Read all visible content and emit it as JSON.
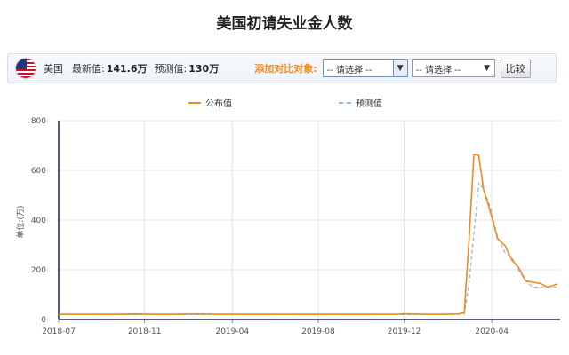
{
  "page": {
    "title": "美国初请失业金人数"
  },
  "toolbar": {
    "flag_icon": "us-flag-icon",
    "country": "美国",
    "latest_label": "最新值:",
    "latest_value": "141.6万",
    "forecast_label": "预测值:",
    "forecast_value": "130万",
    "compare_label": "添加对比对象:",
    "select1_value": "-- 请选择 --",
    "select2_value": "-- 请选择 --",
    "compare_button": "比较"
  },
  "colors": {
    "actual": "#f08a1c",
    "forecast": "#8fbbe0",
    "accent": "#f08a1c"
  },
  "chart_data": {
    "type": "line",
    "title": "",
    "xlabel": "",
    "ylabel": "单位:(万)",
    "ylim": [
      0,
      800
    ],
    "yticks": [
      "0",
      "200",
      "400",
      "600",
      "800"
    ],
    "xlim": [
      0,
      1.0
    ],
    "xticks": [
      {
        "label": "2018-07",
        "pos": 0.0
      },
      {
        "label": "2018-11",
        "pos": 0.1775
      },
      {
        "label": "2019-04",
        "pos": 0.3587
      },
      {
        "label": "2019-08",
        "pos": 0.5362
      },
      {
        "label": "2019-12",
        "pos": 0.7138
      },
      {
        "label": "2020-04",
        "pos": 0.8949
      }
    ],
    "grid": true,
    "legend_position": "top",
    "series": [
      {
        "name": "公布值",
        "style": "solid",
        "values": [
          [
            0.0,
            21
          ],
          [
            0.04,
            21
          ],
          [
            0.08,
            21
          ],
          [
            0.12,
            21
          ],
          [
            0.16,
            22
          ],
          [
            0.2,
            21
          ],
          [
            0.24,
            21
          ],
          [
            0.27,
            22
          ],
          [
            0.3,
            22
          ],
          [
            0.33,
            21
          ],
          [
            0.36,
            21
          ],
          [
            0.39,
            21
          ],
          [
            0.42,
            21
          ],
          [
            0.46,
            21
          ],
          [
            0.5,
            21
          ],
          [
            0.54,
            21
          ],
          [
            0.58,
            21
          ],
          [
            0.62,
            21
          ],
          [
            0.66,
            21
          ],
          [
            0.7,
            21
          ],
          [
            0.714,
            23
          ],
          [
            0.73,
            22
          ],
          [
            0.76,
            21
          ],
          [
            0.8,
            21
          ],
          [
            0.825,
            22
          ],
          [
            0.838,
            28
          ],
          [
            0.848,
            328
          ],
          [
            0.858,
            665
          ],
          [
            0.868,
            660
          ],
          [
            0.878,
            522
          ],
          [
            0.892,
            432
          ],
          [
            0.907,
            325
          ],
          [
            0.922,
            298
          ],
          [
            0.936,
            240
          ],
          [
            0.95,
            210
          ],
          [
            0.965,
            155
          ],
          [
            0.98,
            150
          ],
          [
            0.995,
            145
          ],
          [
            1.01,
            130
          ],
          [
            1.03,
            142
          ]
        ]
      },
      {
        "name": "预测值",
        "style": "dashed",
        "values": [
          [
            0.0,
            20
          ],
          [
            0.1,
            20
          ],
          [
            0.2,
            20
          ],
          [
            0.3,
            20
          ],
          [
            0.4,
            20
          ],
          [
            0.5,
            20
          ],
          [
            0.6,
            20
          ],
          [
            0.7,
            20
          ],
          [
            0.8,
            20
          ],
          [
            0.825,
            21
          ],
          [
            0.838,
            22
          ],
          [
            0.848,
            150
          ],
          [
            0.858,
            350
          ],
          [
            0.868,
            550
          ],
          [
            0.878,
            525
          ],
          [
            0.892,
            450
          ],
          [
            0.907,
            330
          ],
          [
            0.922,
            270
          ],
          [
            0.936,
            250
          ],
          [
            0.95,
            200
          ],
          [
            0.965,
            155
          ],
          [
            0.98,
            130
          ],
          [
            0.995,
            130
          ],
          [
            1.01,
            130
          ],
          [
            1.03,
            130
          ]
        ]
      }
    ]
  }
}
